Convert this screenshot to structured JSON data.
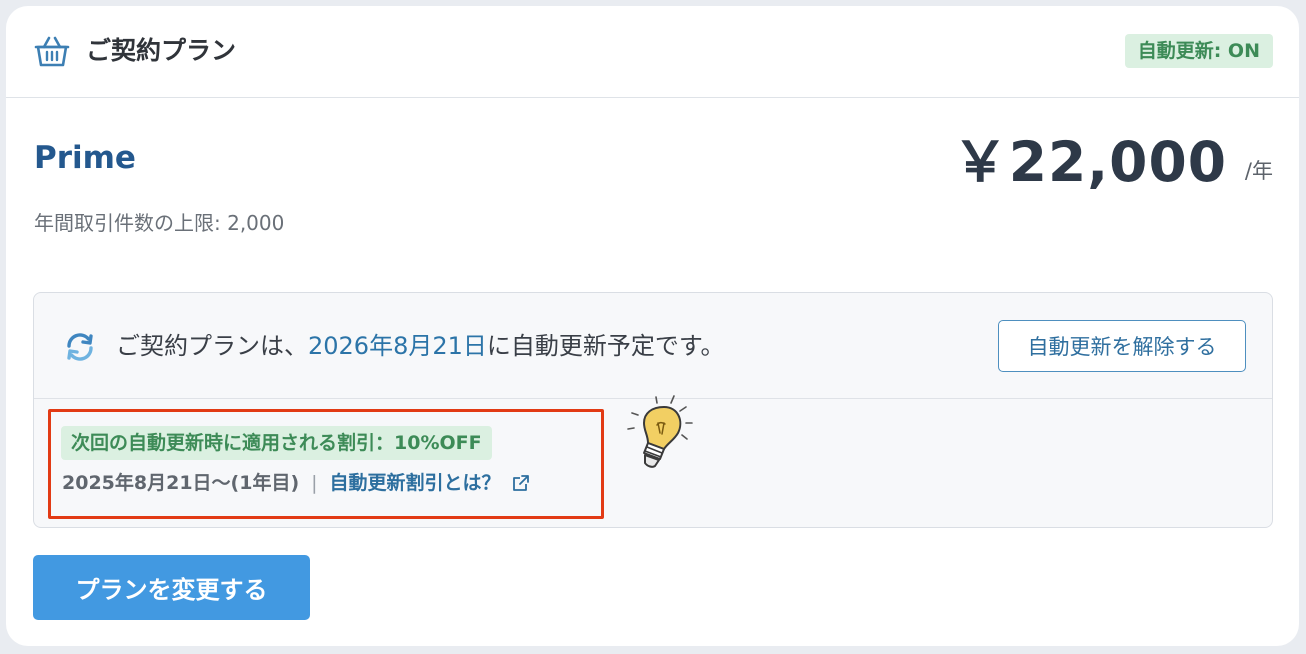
{
  "header": {
    "icon": "basket-icon",
    "title": "ご契約プラン",
    "auto_renew_badge": "自動更新: ON"
  },
  "plan": {
    "name": "Prime",
    "price": "￥22,000",
    "price_unit": "/年",
    "limit_text": "年間取引件数の上限: 2,000"
  },
  "renewal": {
    "icon": "sync-icon",
    "text_before": "ご契約プランは、",
    "date": "2026年8月21日",
    "text_after": "に自動更新予定です。",
    "cancel_label": "自動更新を解除する"
  },
  "discount": {
    "badge": "次回の自動更新時に適用される割引：10%OFF",
    "period": "2025年8月21日〜(1年目)",
    "separator": "|",
    "link_label": "自動更新割引とは？",
    "link_icon": "external-link-icon",
    "illustration": "light-bulb-icon"
  },
  "actions": {
    "change_plan_label": "プランを変更する"
  },
  "colors": {
    "accent": "#4299e1",
    "plan_name": "#24588e",
    "badge_bg": "#dbf0e1",
    "badge_text": "#3d8b57",
    "highlight_frame": "#e23a14"
  }
}
